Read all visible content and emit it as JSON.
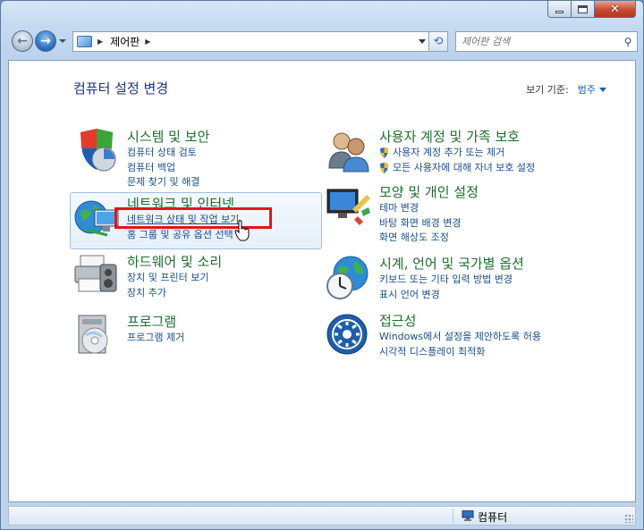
{
  "window": {
    "caption_buttons": {
      "minimize": "minimize-icon",
      "maximize": "maximize-icon",
      "close": "close-icon"
    }
  },
  "nav": {
    "address": {
      "crumb": "제어판"
    },
    "search": {
      "placeholder": "제어판 검색"
    }
  },
  "page": {
    "title": "컴퓨터 설정 변경",
    "view_by_label": "보기 기준:",
    "view_by_value": "범주"
  },
  "categories": [
    {
      "id": "system-security",
      "title": "시스템 및 보안",
      "links": [
        "컴퓨터 상태 검토",
        "컴퓨터 백업",
        "문제 찾기 및 해결"
      ]
    },
    {
      "id": "network-internet",
      "title": "네트워크 및 인터넷",
      "links": [
        "네트워크 상태 및 작업 보기",
        "홈 그룹 및 공유 옵션 선택"
      ]
    },
    {
      "id": "hardware-sound",
      "title": "하드웨어 및 소리",
      "links": [
        "장치 및 프린터 보기",
        "장치 추가"
      ]
    },
    {
      "id": "programs",
      "title": "프로그램",
      "links": [
        "프로그램 제거"
      ]
    },
    {
      "id": "user-accounts",
      "title": "사용자 계정 및 가족 보호",
      "links": [
        "사용자 계정 추가 또는 제거",
        "모든 사용자에 대해 자녀 보호 설정"
      ]
    },
    {
      "id": "appearance",
      "title": "모양 및 개인 설정",
      "links": [
        "테마 변경",
        "바탕 화면 배경 변경",
        "화면 해상도 조정"
      ]
    },
    {
      "id": "clock-region",
      "title": "시계, 언어 및 국가별 옵션",
      "links": [
        "키보드 또는 기타 입력 방법 변경",
        "표시 언어 변경"
      ]
    },
    {
      "id": "ease-of-access",
      "title": "접근성",
      "links": [
        "Windows에서 설정을 제안하도록 허용",
        "시각적 디스플레이 최적화"
      ]
    }
  ],
  "status": {
    "text": "컴퓨터"
  }
}
